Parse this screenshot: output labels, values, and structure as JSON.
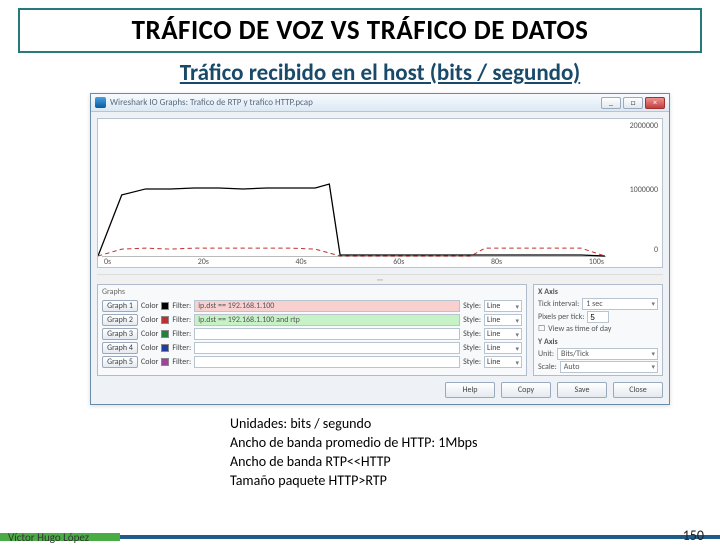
{
  "title": "TRÁFICO DE VOZ VS TRÁFICO DE DATOS",
  "subtitle": "Tráfico recibido en el host (bits / segundo)",
  "window": {
    "title": "Wireshark IO Graphs: Trafico de RTP y trafico HTTP.pcap",
    "min": "_",
    "max": "□",
    "close": "×"
  },
  "chart_data": {
    "type": "line",
    "xlabel": "",
    "ylabel": "",
    "ylim": [
      0,
      2000000
    ],
    "y_ticks": [
      "2000000",
      "1000000",
      "0"
    ],
    "x_ticks": [
      "0s",
      "20s",
      "40s",
      "60s",
      "80s",
      "100s"
    ],
    "series": [
      {
        "name": "ip.dst == 192.168.1.100",
        "color": "#000000",
        "x": [
          0,
          5,
          10,
          15,
          20,
          25,
          30,
          35,
          40,
          45,
          48,
          50,
          55,
          60,
          65,
          70,
          75,
          80,
          85,
          90,
          95,
          100,
          105
        ],
        "values": [
          0,
          900000,
          980000,
          990000,
          1000000,
          990000,
          985000,
          995000,
          1000000,
          990000,
          1050000,
          20000,
          20000,
          20000,
          20000,
          20000,
          20000,
          20000,
          20000,
          20000,
          20000,
          20000,
          0
        ]
      },
      {
        "name": "ip.dst == 192.168.1.100 and rtp",
        "color": "#c03030",
        "x": [
          0,
          5,
          10,
          15,
          20,
          25,
          30,
          35,
          40,
          45,
          50,
          55,
          60,
          65,
          70,
          75,
          80,
          85,
          90,
          95,
          100,
          105
        ],
        "values": [
          0,
          100000,
          110000,
          108000,
          110000,
          109000,
          110000,
          110000,
          110000,
          108000,
          0,
          0,
          0,
          0,
          0,
          0,
          0,
          110000,
          110000,
          110000,
          110000,
          0
        ]
      }
    ]
  },
  "graphs": {
    "panel_title": "Graphs",
    "style_label": "Style:",
    "color_label": "Color",
    "filter_label": "Filter:",
    "line": "Line",
    "rows": [
      {
        "btn": "Graph 1",
        "filter": "ip.dst == 192.168.1.100",
        "hl": "",
        "swatch": "#000000"
      },
      {
        "btn": "Graph 2",
        "filter": "ip.dst == 192.168.1.100 and rtp",
        "hl": "green",
        "swatch": "#c03030"
      },
      {
        "btn": "Graph 3",
        "filter": "",
        "hl": "",
        "swatch": "#208040"
      },
      {
        "btn": "Graph 4",
        "filter": "",
        "hl": "",
        "swatch": "#2040a0"
      },
      {
        "btn": "Graph 5",
        "filter": "",
        "hl": "",
        "swatch": "#a040a0"
      }
    ]
  },
  "xaxis": {
    "title": "X Axis",
    "tick_label": "Tick interval:",
    "tick_val": "1 sec",
    "pix_label": "Pixels per tick:",
    "pix_val": "5",
    "timeofday": "View as time of day"
  },
  "yaxis": {
    "title": "Y Axis",
    "unit_label": "Unit:",
    "unit_val": "Bits/Tick",
    "scale_label": "Scale:",
    "scale_val": "Auto"
  },
  "footer_buttons": {
    "help": "Help",
    "copy": "Copy",
    "save": "Save",
    "close": "Close"
  },
  "notes": {
    "l1": "Unidades: bits / segundo",
    "l2": "Ancho de banda promedio de HTTP: 1Mbps",
    "l3": "Ancho de banda RTP<<HTTP",
    "l4": "Tamaño paquete HTTP>RTP"
  },
  "author": "Víctor Hugo López",
  "page": "150"
}
